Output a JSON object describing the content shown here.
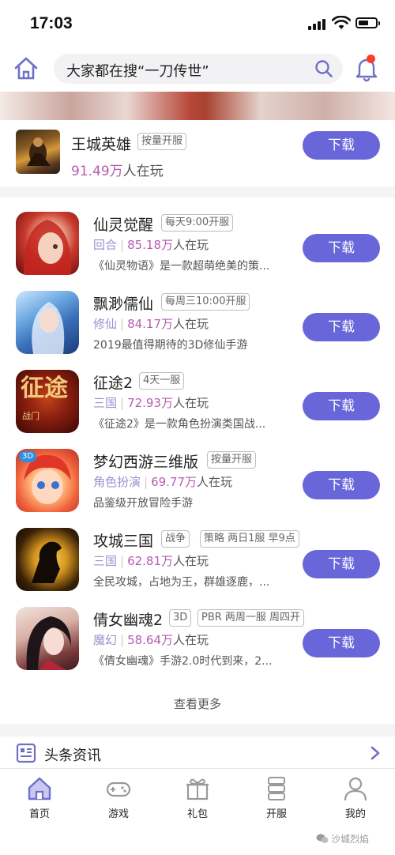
{
  "status_bar": {
    "time": "17:03"
  },
  "header": {
    "search_placeholder": "大家都在搜“一刀传世”"
  },
  "featured": {
    "name": "王城英雄",
    "tag": "按量开服",
    "players": "91.49万",
    "players_suffix": "人在玩",
    "download_label": "下载"
  },
  "games": [
    {
      "name": "仙灵觉醒",
      "tags": [
        "每天9:00开服"
      ],
      "category": "回合",
      "players": "85.18万",
      "players_suffix": "人在玩",
      "desc": "《仙灵物语》是一款超萌绝美的策...",
      "download_label": "下载"
    },
    {
      "name": "飘渺儒仙",
      "tags": [
        "每周三10:00开服"
      ],
      "category": "修仙",
      "players": "84.17万",
      "players_suffix": "人在玩",
      "desc": "2019最值得期待的3D修仙手游",
      "download_label": "下载"
    },
    {
      "name": "征途2",
      "tags": [
        "4天一服"
      ],
      "category": "三国",
      "players": "72.93万",
      "players_suffix": "人在玩",
      "desc": "《征途2》是一款角色扮演类国战...",
      "download_label": "下载"
    },
    {
      "name": "梦幻西游三维版",
      "tags": [
        "按量开服"
      ],
      "category": "角色扮演",
      "players": "69.77万",
      "players_suffix": "人在玩",
      "desc": "品鉴级开放冒险手游",
      "download_label": "下载"
    },
    {
      "name": "攻城三国",
      "tags": [
        "战争",
        "策略 两日1服 早9点"
      ],
      "category": "三国",
      "players": "62.81万",
      "players_suffix": "人在玩",
      "desc": "全民攻城，占地为王，群雄逐鹿，...",
      "download_label": "下载"
    },
    {
      "name": "倩女幽魂2",
      "tags": [
        "3D",
        "PBR 两周一服 周四开"
      ],
      "category": "魔幻",
      "players": "58.64万",
      "players_suffix": "人在玩",
      "desc": "《倩女幽魂》手游2.0时代到来，2...",
      "download_label": "下载"
    }
  ],
  "icon_texts": {
    "zhengtu": "征途",
    "zhengtu_small": "战门",
    "mhxy_badge": "3D"
  },
  "more_label": "查看更多",
  "news": {
    "title": "头条资讯"
  },
  "tabs": [
    {
      "label": "首页",
      "icon": "home-icon",
      "active": true
    },
    {
      "label": "游戏",
      "icon": "gamepad-icon"
    },
    {
      "label": "礼包",
      "icon": "gift-icon"
    },
    {
      "label": "开服",
      "icon": "server-icon"
    },
    {
      "label": "我的",
      "icon": "user-icon"
    }
  ],
  "watermark": "沙城烈焰",
  "colors": {
    "accent": "#6866d9",
    "players_number": "#b55db0",
    "category": "#9c8fd0",
    "notification_dot": "#ff3b30"
  }
}
